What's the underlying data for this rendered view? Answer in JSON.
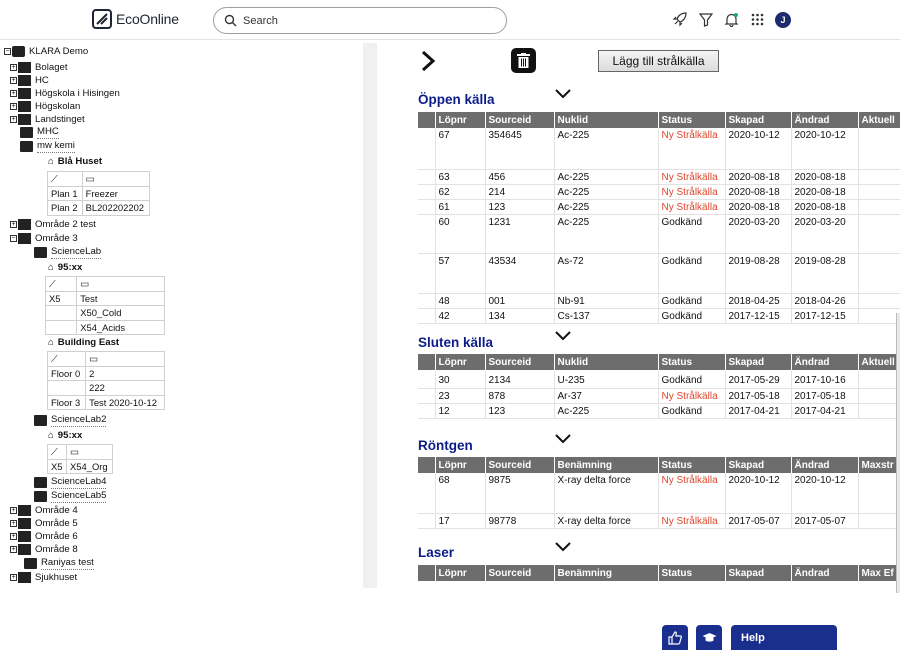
{
  "app": {
    "brand": "EcoOnline",
    "avatar_initial": "J",
    "search_placeholder": "Search"
  },
  "tree": {
    "root": "KLARA Demo",
    "items": [
      {
        "label": "Bolaget"
      },
      {
        "label": "HC"
      },
      {
        "label": "Högskola i Hisingen"
      },
      {
        "label": "Högskolan"
      },
      {
        "label": "Landstinget"
      },
      {
        "label": "MHC"
      },
      {
        "label": "mw kemi"
      },
      {
        "label": "Område 2 test"
      },
      {
        "label": "Område 3"
      },
      {
        "label": "ScienceLab"
      },
      {
        "label": "ScienceLab2"
      },
      {
        "label": "ScienceLab4"
      },
      {
        "label": "ScienceLab5"
      },
      {
        "label": "Område 4"
      },
      {
        "label": "Område 5"
      },
      {
        "label": "Område 6"
      },
      {
        "label": "Område 8"
      },
      {
        "label": "Raniyas test"
      },
      {
        "label": "Sjukhuset"
      }
    ],
    "buildings": [
      {
        "name": "Blå Huset",
        "rows": [
          [
            "Plan 1",
            "Freezer"
          ],
          [
            "Plan 2",
            "BL202202202"
          ]
        ]
      },
      {
        "name": "95:xx",
        "rows": [
          [
            "X5",
            "Test"
          ],
          [
            "",
            "X50_Cold"
          ],
          [
            "",
            "X54_Acids"
          ]
        ]
      },
      {
        "name": "Building East",
        "rows": [
          [
            "Floor 0",
            "2"
          ],
          [
            "",
            "222"
          ],
          [
            "Floor 3",
            "Test 2020-10-12"
          ]
        ]
      },
      {
        "name": "95:xx",
        "rows": [
          [
            "X5",
            "X54_Org"
          ]
        ]
      }
    ]
  },
  "toolbar": {
    "add_label": "Lägg till strålkälla"
  },
  "sections": {
    "open": {
      "title": "Öppen källa",
      "headers": [
        "",
        "Löpnr",
        "Sourceid",
        "Nuklid",
        "Status",
        "Skapad",
        "Ändrad",
        "Aktuell"
      ],
      "rows": [
        [
          "67",
          "354645",
          "Ac-225",
          "Ny Strålkälla",
          "2020-10-12",
          "2020-10-12"
        ],
        [
          "63",
          "456",
          "Ac-225",
          "Ny Strålkälla",
          "2020-08-18",
          "2020-08-18"
        ],
        [
          "62",
          "214",
          "Ac-225",
          "Ny Strålkälla",
          "2020-08-18",
          "2020-08-18"
        ],
        [
          "61",
          "123",
          "Ac-225",
          "Ny Strålkälla",
          "2020-08-18",
          "2020-08-18"
        ],
        [
          "60",
          "1231",
          "Ac-225",
          "Godkänd",
          "2020-03-20",
          "2020-03-20"
        ],
        [
          "57",
          "43534",
          "As-72",
          "Godkänd",
          "2019-08-28",
          "2019-08-28"
        ],
        [
          "48",
          "001",
          "Nb-91",
          "Godkänd",
          "2018-04-25",
          "2018-04-26"
        ],
        [
          "42",
          "134",
          "Cs-137",
          "Godkänd",
          "2017-12-15",
          "2017-12-15"
        ]
      ]
    },
    "closed": {
      "title": "Sluten källa",
      "headers": [
        "",
        "Löpnr",
        "Sourceid",
        "Nuklid",
        "Status",
        "Skapad",
        "Ändrad",
        "Aktuell"
      ],
      "rows": [
        [
          "30",
          "2134",
          "U-235",
          "Godkänd",
          "2017-05-29",
          "2017-10-16"
        ],
        [
          "23",
          "878",
          "Ar-37",
          "Ny Strålkälla",
          "2017-05-18",
          "2017-05-18"
        ],
        [
          "12",
          "123",
          "Ac-225",
          "Godkänd",
          "2017-04-21",
          "2017-04-21"
        ]
      ]
    },
    "xray": {
      "title": "Röntgen",
      "headers": [
        "",
        "Löpnr",
        "Sourceid",
        "Benämning",
        "Status",
        "Skapad",
        "Ändrad",
        "Maxstr"
      ],
      "rows": [
        [
          "68",
          "9875",
          "X-ray delta force",
          "Ny Strålkälla",
          "2020-10-12",
          "2020-10-12"
        ],
        [
          "17",
          "98778",
          "X-ray delta force",
          "Ny Strålkälla",
          "2017-05-07",
          "2017-05-07"
        ]
      ]
    },
    "laser": {
      "title": "Laser",
      "headers": [
        "",
        "Löpnr",
        "Sourceid",
        "Benämning",
        "Status",
        "Skapad",
        "Ändrad",
        "Max Ef"
      ]
    }
  },
  "footer": {
    "help": "Help"
  },
  "colors": {
    "accent": "#0c1d8a",
    "status_new": "#e0462c",
    "header_bg": "#6d6d6d",
    "footer_btn": "#1a2e8e"
  }
}
